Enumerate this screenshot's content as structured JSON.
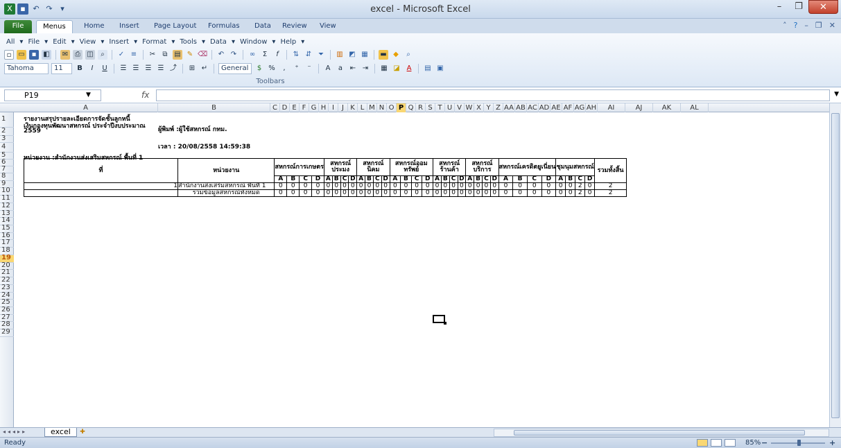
{
  "window": {
    "title": "excel - Microsoft Excel",
    "minimize": "–",
    "restore": "❐",
    "close": "✕"
  },
  "tabs": {
    "file": "File",
    "menus": "Menus",
    "home": "Home",
    "insert": "Insert",
    "page_layout": "Page Layout",
    "formulas": "Formulas",
    "data": "Data",
    "review": "Review",
    "view": "View"
  },
  "menus": [
    "All",
    "File",
    "Edit",
    "View",
    "Insert",
    "Format",
    "Tools",
    "Data",
    "Window",
    "Help"
  ],
  "toolbar": {
    "font_name": "Tahoma",
    "font_size": "11",
    "bold": "B",
    "italic": "I",
    "underline": "U",
    "number_format": "General",
    "percent": "%",
    "comma": ",",
    "label": "Toolbars"
  },
  "formula_bar": {
    "name_box": "P19",
    "fx": "fx",
    "value": ""
  },
  "columns": [
    {
      "label": "A",
      "w": 0
    },
    {
      "label": "B"
    },
    {
      "label": "C"
    },
    {
      "label": "D"
    },
    {
      "label": "E"
    },
    {
      "label": "F"
    },
    {
      "label": "G"
    },
    {
      "label": "H"
    },
    {
      "label": "I"
    },
    {
      "label": "J"
    },
    {
      "label": "K"
    },
    {
      "label": "L"
    },
    {
      "label": "M"
    },
    {
      "label": "N"
    },
    {
      "label": "O"
    },
    {
      "label": "P"
    },
    {
      "label": "Q"
    },
    {
      "label": "R"
    },
    {
      "label": "S"
    },
    {
      "label": "T"
    },
    {
      "label": "U"
    },
    {
      "label": "V"
    },
    {
      "label": "W"
    },
    {
      "label": "X"
    },
    {
      "label": "Y"
    },
    {
      "label": "Z"
    },
    {
      "label": "AA"
    },
    {
      "label": "AB"
    },
    {
      "label": "AC"
    },
    {
      "label": "AD"
    },
    {
      "label": "AE"
    },
    {
      "label": "AF"
    },
    {
      "label": "AG"
    },
    {
      "label": "AH"
    },
    {
      "label": "AI"
    },
    {
      "label": "AJ"
    },
    {
      "label": "AK"
    },
    {
      "label": "AL"
    }
  ],
  "selected_column": "P",
  "selected_row": "19",
  "rows": [
    "1",
    "2",
    "3",
    "4",
    "5",
    "6",
    "7",
    "8",
    "9",
    "10",
    "11",
    "12",
    "13",
    "14",
    "15",
    "16",
    "17",
    "18",
    "19",
    "20",
    "21",
    "22",
    "23",
    "24",
    "25",
    "26",
    "27",
    "28",
    "29"
  ],
  "report": {
    "title1": "รายงานสรุปรายละเอียดการจัดชั้นลูกหนี้",
    "title2": "เงินกองทุนพัฒนาสหกรณ์ ประจำปีงบประมาณ",
    "year": "2559",
    "printed_by": "ผู้พิมพ์ :ผู้ใช้สหกรณ์ กทม.",
    "time": "เวลา : 20/08/2558 14:59:38",
    "unit": "หน่วยงาน :สำนักงานส่งเสริมสหกรณ์ พื้นที่ 1",
    "col_no": "ที่",
    "col_unit": "หน่วยงาน",
    "groups": [
      "สหกรณ์การเกษตร",
      "สหกรณ์ ประมง",
      "สหกรณ์ นิคม",
      "สหกรณ์ออม ทรัพย์",
      "สหกรณ์ ร้านค้า",
      "สหกรณ์ บริการ",
      "สหกรณ์เครดิตยูเนี่ยน",
      "ชุมนุมสหกรณ์"
    ],
    "total_header": "รวมทั้งสิ้น",
    "sub": [
      "A",
      "B",
      "C",
      "D"
    ],
    "data_rows": [
      {
        "no": "1",
        "name": "สำนักงานส่งเสริมสหกรณ์ พื้นที่ 1",
        "values": [
          "0",
          "0",
          "0",
          "0",
          "0",
          "0",
          "0",
          "0",
          "0",
          "0",
          "0",
          "0",
          "0",
          "0",
          "0",
          "0",
          "0",
          "0",
          "0",
          "0",
          "0",
          "0",
          "0",
          "0",
          "0",
          "0",
          "0",
          "0",
          "0",
          "0",
          "2",
          "0"
        ],
        "total": "2"
      },
      {
        "no": "",
        "name": "รวมข้อมูลสหกรณ์ทั้งหมด",
        "values": [
          "0",
          "0",
          "0",
          "0",
          "0",
          "0",
          "0",
          "0",
          "0",
          "0",
          "0",
          "0",
          "0",
          "0",
          "0",
          "0",
          "0",
          "0",
          "0",
          "0",
          "0",
          "0",
          "0",
          "0",
          "0",
          "0",
          "0",
          "0",
          "0",
          "0",
          "2",
          "0"
        ],
        "total": "2"
      }
    ]
  },
  "sheet_tabs": {
    "active": "excel"
  },
  "status": {
    "ready": "Ready",
    "zoom": "85%",
    "minus": "−",
    "plus": "+"
  }
}
